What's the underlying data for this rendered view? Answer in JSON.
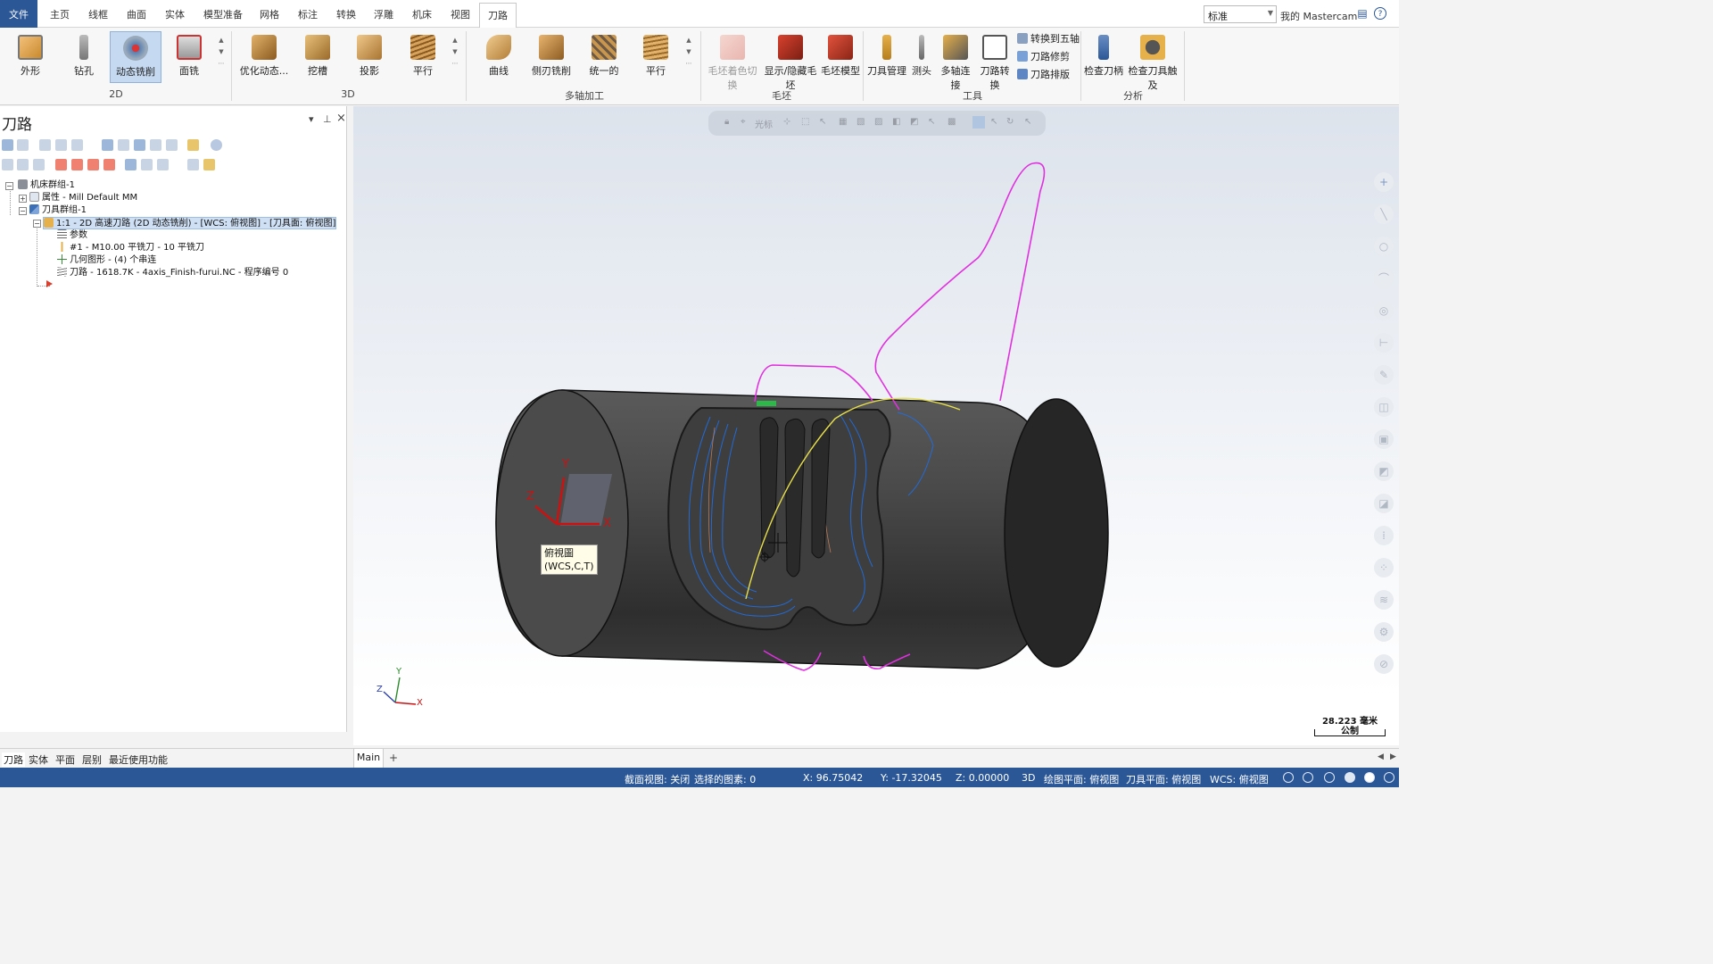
{
  "tabs": [
    "文件",
    "主页",
    "线框",
    "曲面",
    "实体",
    "模型准备",
    "网格",
    "标注",
    "转换",
    "浮雕",
    "机床",
    "视图",
    "刀路"
  ],
  "active_tab": "刀路",
  "top_right": {
    "style_value": "标准",
    "my_mastercam": "我的 Mastercam"
  },
  "ribbon": {
    "g2d": {
      "label": "2D",
      "buttons": [
        "外形",
        "钻孔",
        "动态铣削",
        "面铣"
      ]
    },
    "g3d": {
      "label": "3D",
      "buttons": [
        "优化动态...",
        "挖槽",
        "投影",
        "平行"
      ]
    },
    "gmulti": {
      "label": "多轴加工",
      "buttons": [
        "曲线",
        "侧刃铣削",
        "统一的",
        "平行"
      ]
    },
    "gstock": {
      "label": "毛坯",
      "buttons": [
        "毛坯着色切换",
        "显示/隐藏毛坯",
        "毛坯模型"
      ]
    },
    "gtools": {
      "label": "工具",
      "buttons": [
        "刀具管理",
        "测头",
        "多轴连接",
        "刀路转换"
      ],
      "small": [
        "转换到五轴",
        "刀路修剪",
        "刀路排版"
      ]
    },
    "ganalysis": {
      "label": "分析",
      "buttons": [
        "检查刀柄",
        "检查刀具触及"
      ]
    }
  },
  "left_panel": {
    "title": "刀路",
    "tree": [
      {
        "text": "机床群组-1"
      },
      {
        "text": "属性 - Mill Default MM"
      },
      {
        "text": "刀具群组-1"
      },
      {
        "text": "1:1 - 2D 高速刀路 (2D 动态铣削) - [WCS: 俯视图] - [刀具面: 俯视图]"
      },
      {
        "text": "参数"
      },
      {
        "text": "#1 - M10.00 平铣刀 - 10 平铣刀"
      },
      {
        "text": "几何图形 - (4) 个串连"
      },
      {
        "text": "刀路 - 1618.7K - 4axis_Finish-furui.NC - 程序编号 0"
      }
    ],
    "bottom_tabs": [
      "刀路",
      "实体",
      "平面",
      "层别",
      "最近使用功能"
    ]
  },
  "viewport": {
    "view_toolbar_label": "光标",
    "view_label_line1": "俯視圖",
    "view_label_line2": "(WCS,C,T)",
    "axis_x": "X",
    "axis_y": "Y",
    "axis_z": "Z",
    "scale_value": "28.223 毫米",
    "scale_unit": "公制"
  },
  "doc_tabs": {
    "main": "Main",
    "add": "+"
  },
  "status": {
    "section_view": "截面视图: 关闭",
    "selected": "选择的图素: 0",
    "x": "X:  96.75042",
    "y": "Y:  -17.32045",
    "z": "Z:  0.00000",
    "mode": "3D",
    "draw_plane": "绘图平面: 俯视图",
    "tool_plane": "刀具平面: 俯视图",
    "wcs": "WCS: 俯视图"
  },
  "colors": {
    "file_tab": "#2b5797",
    "status_bar": "#2b5797",
    "toolpath_blue": "#1e6fe8",
    "rapid_magenta": "#e030e0"
  }
}
